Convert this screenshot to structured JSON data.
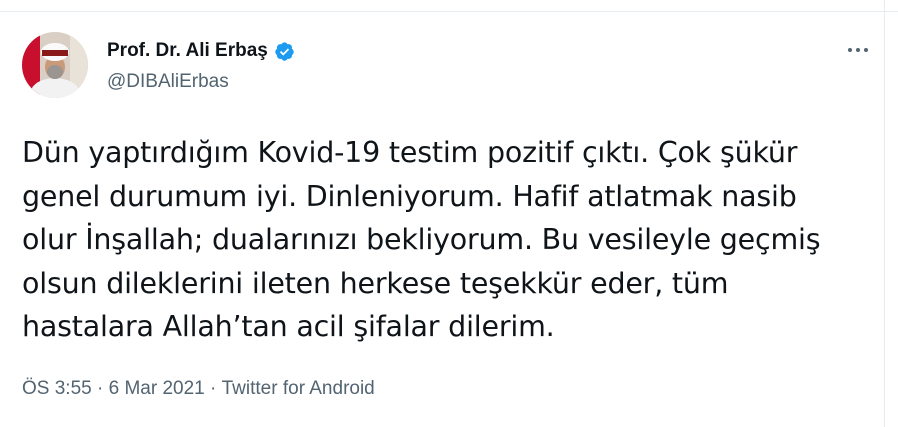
{
  "author": {
    "name": "Prof. Dr. Ali Erbaş",
    "handle": "@DIBAliErbas"
  },
  "tweet": {
    "lines": [
      "Dün yaptırdığım Kovid-19 testim pozitif çıktı. Çok şükür",
      "genel durumum iyi. Dinleniyorum. Hafif atlatmak nasib",
      "olur İnşallah; dualarınızı bekliyorum. Bu vesileyle geçmiş",
      "olsun dileklerini ileten herkese teşekkür eder, tüm",
      "hastalara Allah’tan acil şifalar dilerim."
    ]
  },
  "meta": {
    "time": "ÖS 3:55",
    "separator": " · ",
    "date": "6 Mar 2021",
    "source": "Twitter for Android"
  },
  "icons": {
    "verified": "verified-badge-icon",
    "more": "more-options-icon"
  },
  "colors": {
    "verified_blue": "#1d9bf0",
    "secondary_text": "#536471"
  }
}
